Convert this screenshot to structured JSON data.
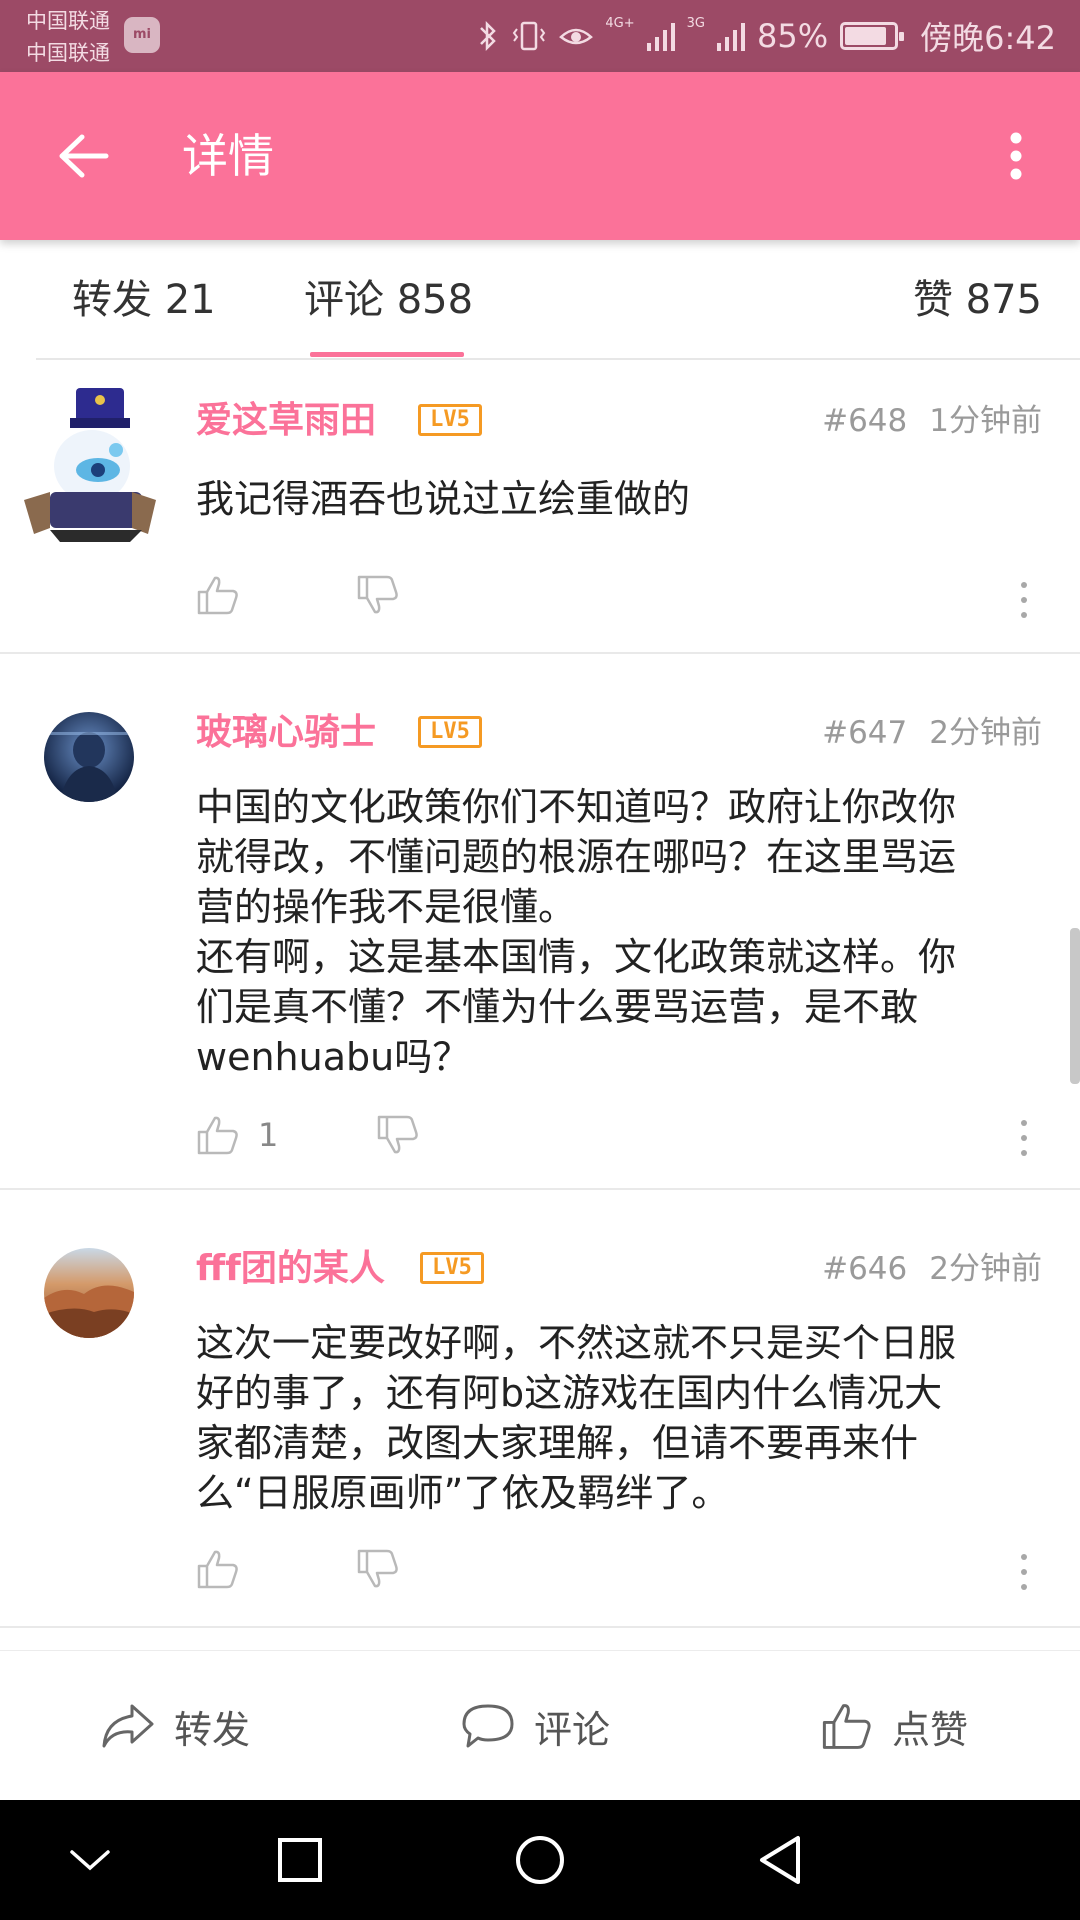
{
  "status_bar": {
    "carrier1": "中国联通",
    "carrier2": "中国联通",
    "mi_label": "mi",
    "net1": "4G+",
    "net2": "3G",
    "battery": "85%",
    "battery_level": 0.85,
    "time": "傍晚6:42"
  },
  "header": {
    "title": "详情",
    "back_icon": "arrow-left-icon",
    "more_icon": "more-vertical-icon"
  },
  "tabs": {
    "forward": "转发 21",
    "comment": "评论 858",
    "like": "赞 875",
    "active": "comment"
  },
  "comments": [
    {
      "username": "爱这草雨田",
      "level": "LV5",
      "floor": "#648",
      "time": "1分钟前",
      "content": "我记得酒吞也说过立绘重做的",
      "likes": ""
    },
    {
      "username": "玻璃心骑士",
      "level": "LV5",
      "floor": "#647",
      "time": "2分钟前",
      "content": "中国的文化政策你们不知道吗？政府让你改你\n就得改，不懂问题的根源在哪吗？在这里骂运\n营的操作我不是很懂。\n还有啊，这是基本国情，文化政策就这样。你\n们是真不懂？不懂为什么要骂运营，是不敢\nwenhuabu吗？",
      "likes": "1"
    },
    {
      "username": "fff团的某人",
      "level": "LV5",
      "floor": "#646",
      "time": "2分钟前",
      "content": "这次一定要改好啊，不然这就不只是买个日服\n好的事了，还有阿b这游戏在国内什么情况大\n家都清楚，改图大家理解，但请不要再来什\n么“日服原画师”了依及羁绊了。",
      "likes": ""
    }
  ],
  "bottom_bar": {
    "forward": "转发",
    "comment": "评论",
    "like": "点赞"
  },
  "colors": {
    "accent": "#fb7299",
    "status_bar": "#9c4a66",
    "level_badge": "#f59a23"
  }
}
